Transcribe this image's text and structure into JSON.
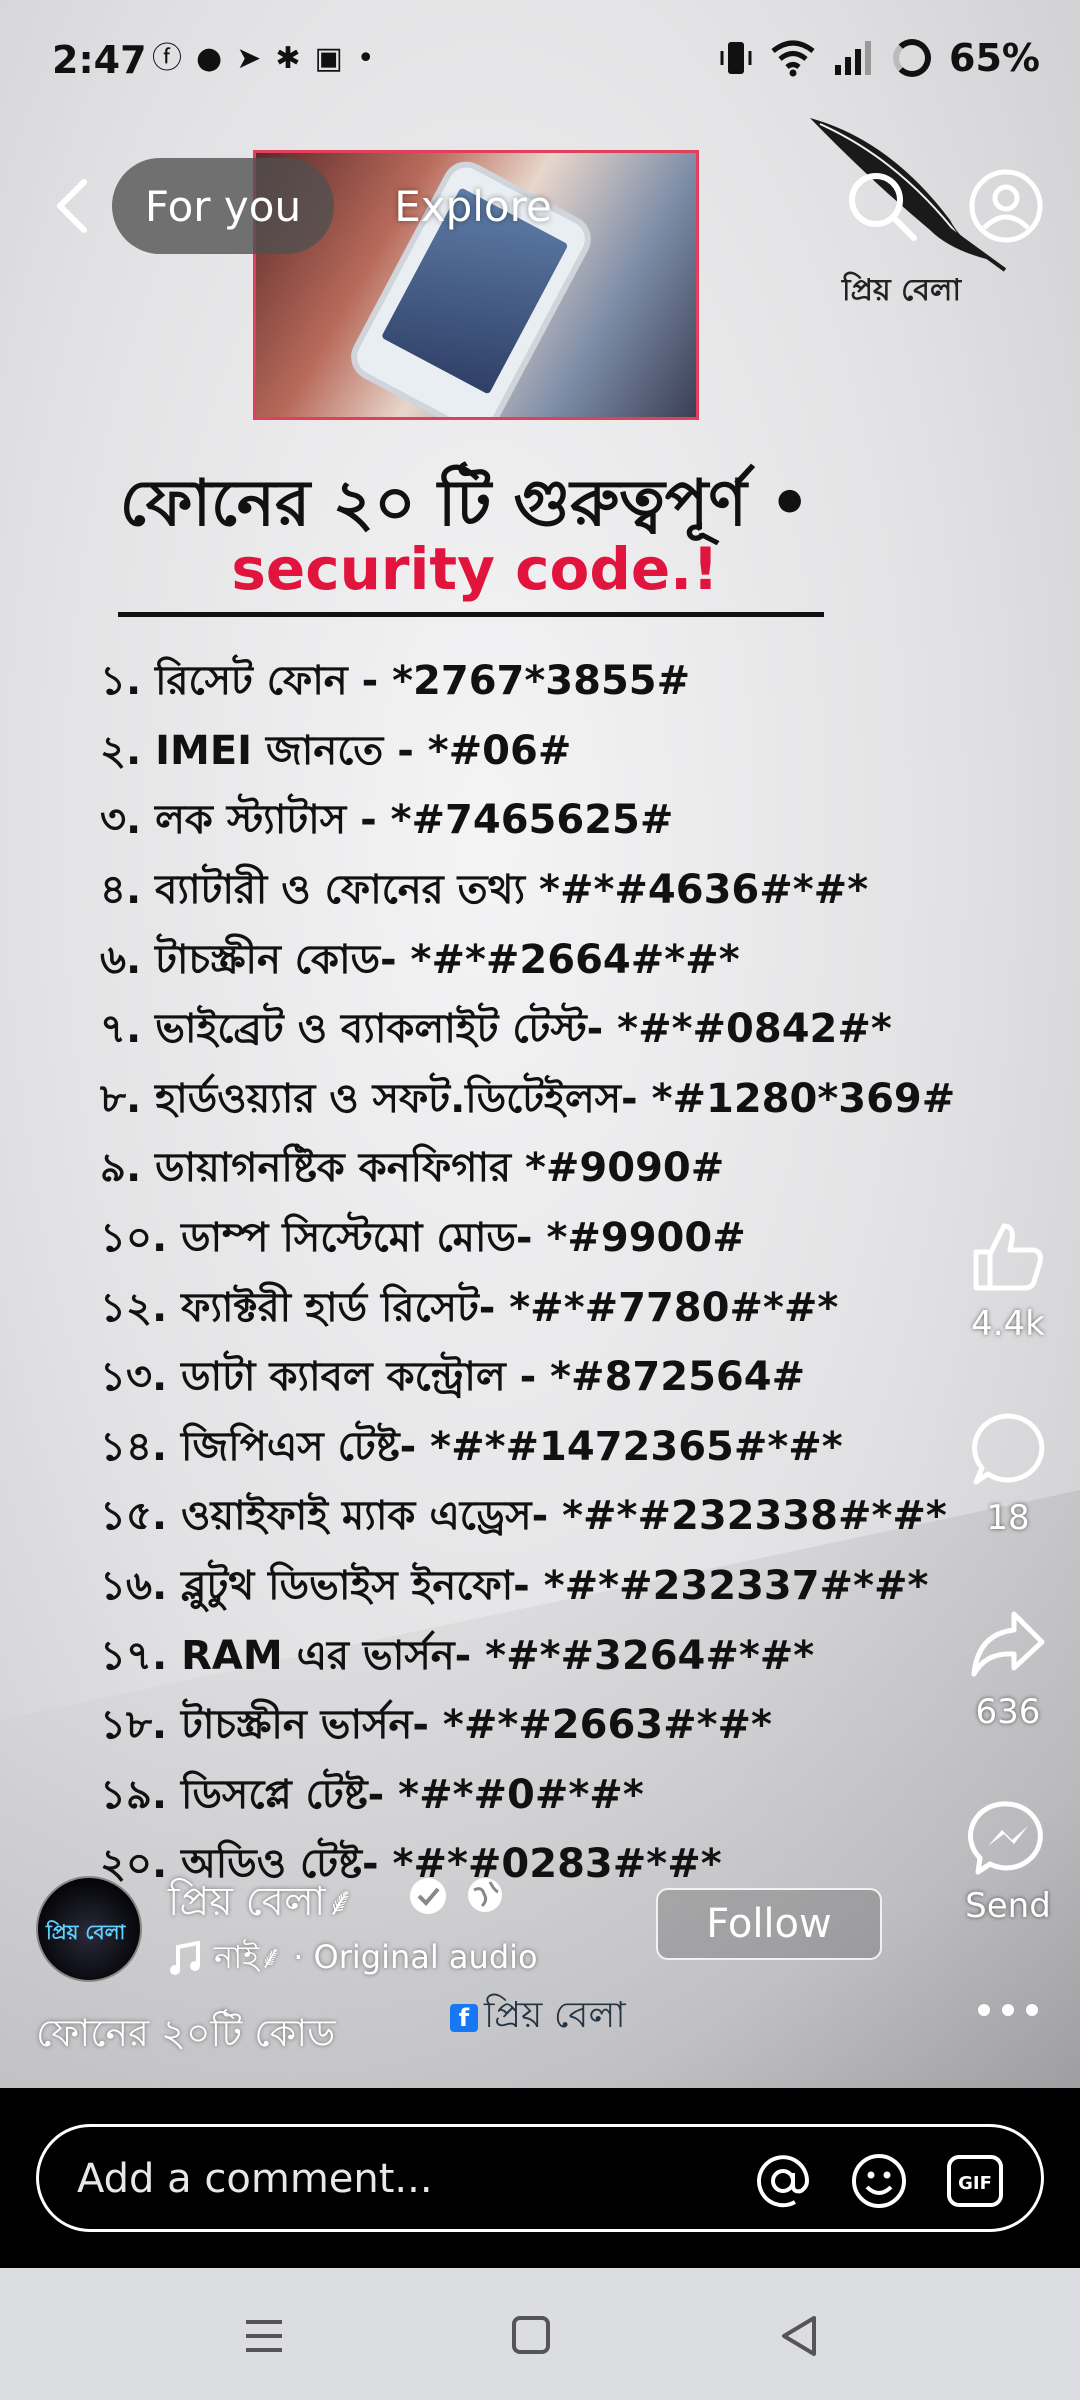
{
  "status_bar": {
    "time": "2:47",
    "battery": "65%",
    "notification_icons": [
      "facebook-icon",
      "messenger-icon",
      "telegram-icon",
      "app-icon",
      "app-icon",
      "dot-icon"
    ]
  },
  "top_nav": {
    "tabs": [
      {
        "label": "For you",
        "active": true
      },
      {
        "label": "Explore",
        "active": false
      }
    ]
  },
  "poster": {
    "brand_text": "প্রিয় বেলা",
    "title": "ফোনের ২০ টি গুরুত্বপূর্ণ •",
    "subtitle": "security code.!",
    "codes": [
      "১. রিসেট ফোন - *2767*3855#",
      "২. IMEI জানতে - *#06#",
      "৩. লক স্ট্যাটাস - *#7465625#",
      "৪. ব্যাটারী ও ফোনের তথ্য *#*#4636#*#*",
      "৬. টাচস্ক্রীন কোড- *#*#2664#*#*",
      "৭. ভাইব্রেট ও ব্যাকলাইট টেস্ট- *#*#0842#*",
      "৮. হার্ডওয়্যার ও সফট.ডিটেইলস- *#1280*369#",
      "৯. ডায়াগনষ্টিক কনফিগার *#9090#",
      "১০. ডাম্প সিস্টেমো মোড- *#9900#",
      "১২. ফ্যাক্টরী হার্ড রিসেট- *#*#7780#*#*",
      "১৩. ডাটা ক্যাবল কন্ট্রোল - *#872564#",
      "১৪. জিপিএস টেষ্ট- *#*#1472365#*#*",
      "১৫. ওয়াইফাই ম্যাক এড্রেস- *#*#232338#*#*",
      "১৬. ব্লুটুথ ডিভাইস ইনফো- *#*#232337#*#*",
      "১৭. RAM এর ভার্সন- *#*#3264#*#*",
      "১৮. টাচস্ক্রীন ভার্সন- *#*#2663#*#*",
      "১৯. ডিসপ্লে টেষ্ট- *#*#0#*#*",
      "২০. অডিও টেষ্ট- *#*#0283#*#*"
    ],
    "fb_tag": "প্রিয় বেলা"
  },
  "actions": {
    "like_count": "4.4k",
    "comment_count": "18",
    "share_count": "636",
    "send_label": "Send"
  },
  "author": {
    "name": "প্রিয় বেলা⸙",
    "audio": "নাই⸙ · Original audio",
    "avatar_text": "প্রিয় বেলা",
    "follow_label": "Follow",
    "caption": "ফোনের ২০টি কোড"
  },
  "comment": {
    "placeholder": "Add a comment..."
  },
  "colors": {
    "accent_red": "#e0143c",
    "photo_border": "#e0405b"
  }
}
